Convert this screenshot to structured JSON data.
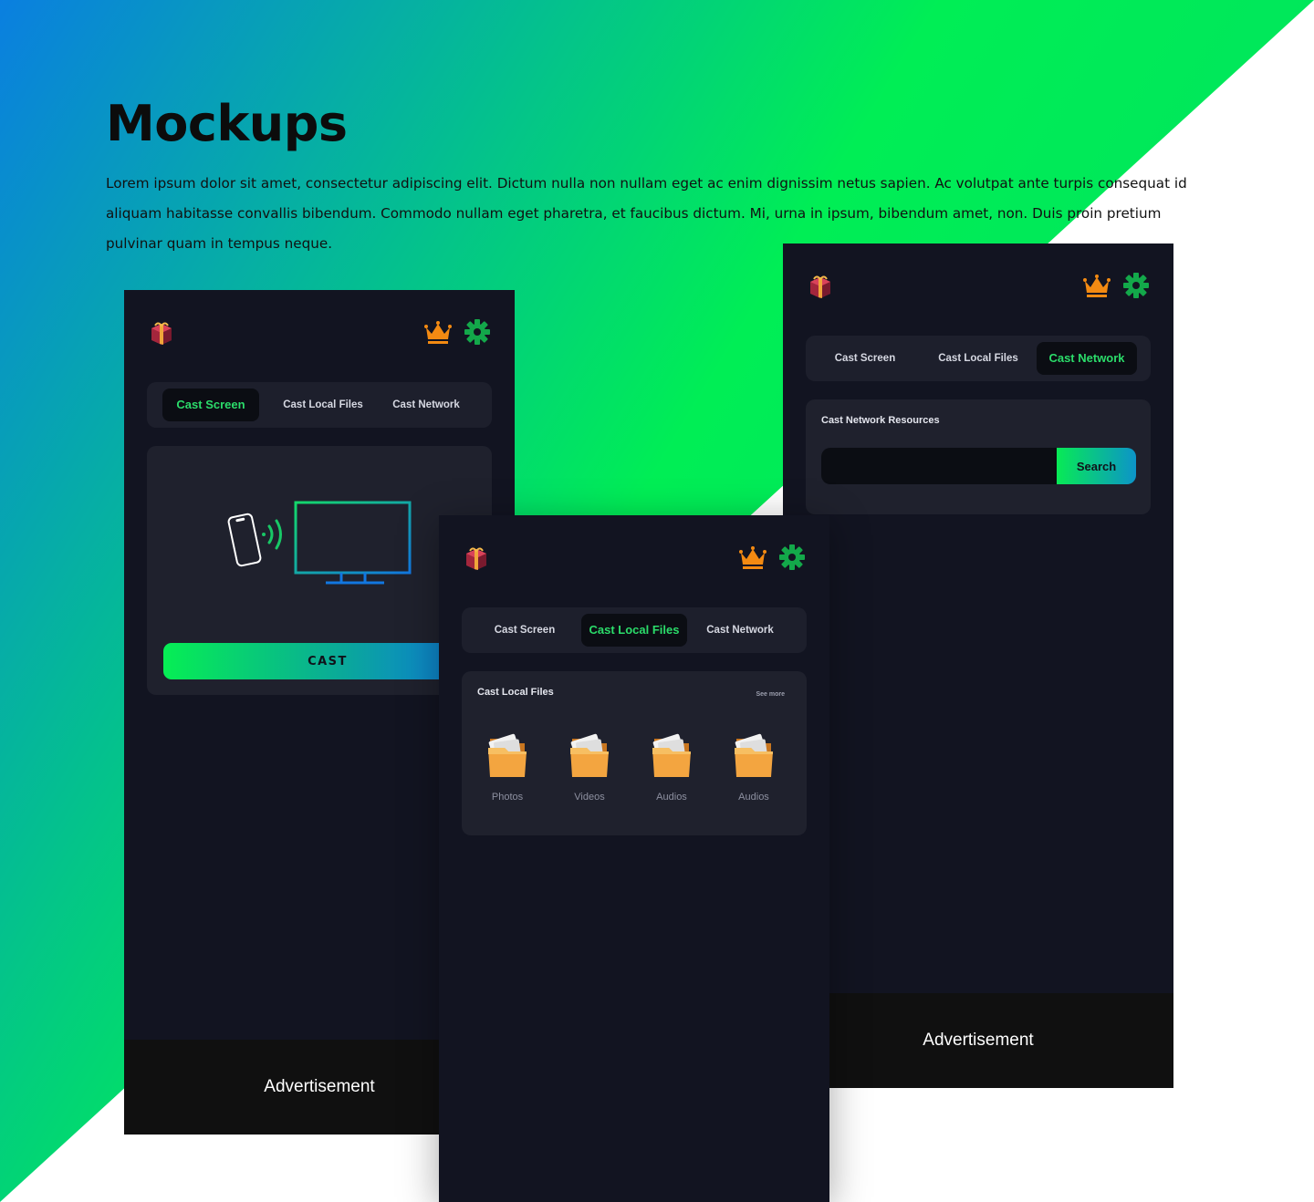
{
  "page": {
    "heading": "Mockups",
    "intro": "Lorem ipsum dolor sit amet, consectetur adipiscing elit. Dictum nulla non nullam eget ac enim dignissim netus sapien. Ac volutpat ante turpis consequat id aliquam habitasse convallis bibendum. Commodo nullam eget pharetra, et faucibus dictum. Mi, urna in ipsum, bibendum amet, non. Duis proin pretium pulvinar quam in tempus neque."
  },
  "colors": {
    "gradient_start": "#0a7fe0",
    "gradient_end": "#00ee55",
    "phone_bg": "#121421",
    "card_bg": "#1f212d",
    "active_tab_text": "#2bdc6a",
    "crown": "#f38a12",
    "gear": "#13a84a"
  },
  "icons": [
    "gift-icon",
    "crown-icon",
    "gear-icon",
    "phone-icon",
    "wifi-waves-icon",
    "tv-icon",
    "folder-icon"
  ],
  "tabs": {
    "cast_screen": "Cast Screen",
    "cast_local_files": "Cast Local Files",
    "cast_network": "Cast Network"
  },
  "screen_cast": {
    "button_label": "CAST",
    "ad_label": "Advertisement"
  },
  "screen_network": {
    "card_title": "Cast Network Resources",
    "search_value": "",
    "search_button": "Search",
    "ad_label": "Advertisement"
  },
  "screen_local": {
    "card_title": "Cast Local Files",
    "see_more": "See more",
    "folders": [
      {
        "label": "Photos"
      },
      {
        "label": "Videos"
      },
      {
        "label": "Audios"
      },
      {
        "label": "Audios"
      }
    ]
  }
}
